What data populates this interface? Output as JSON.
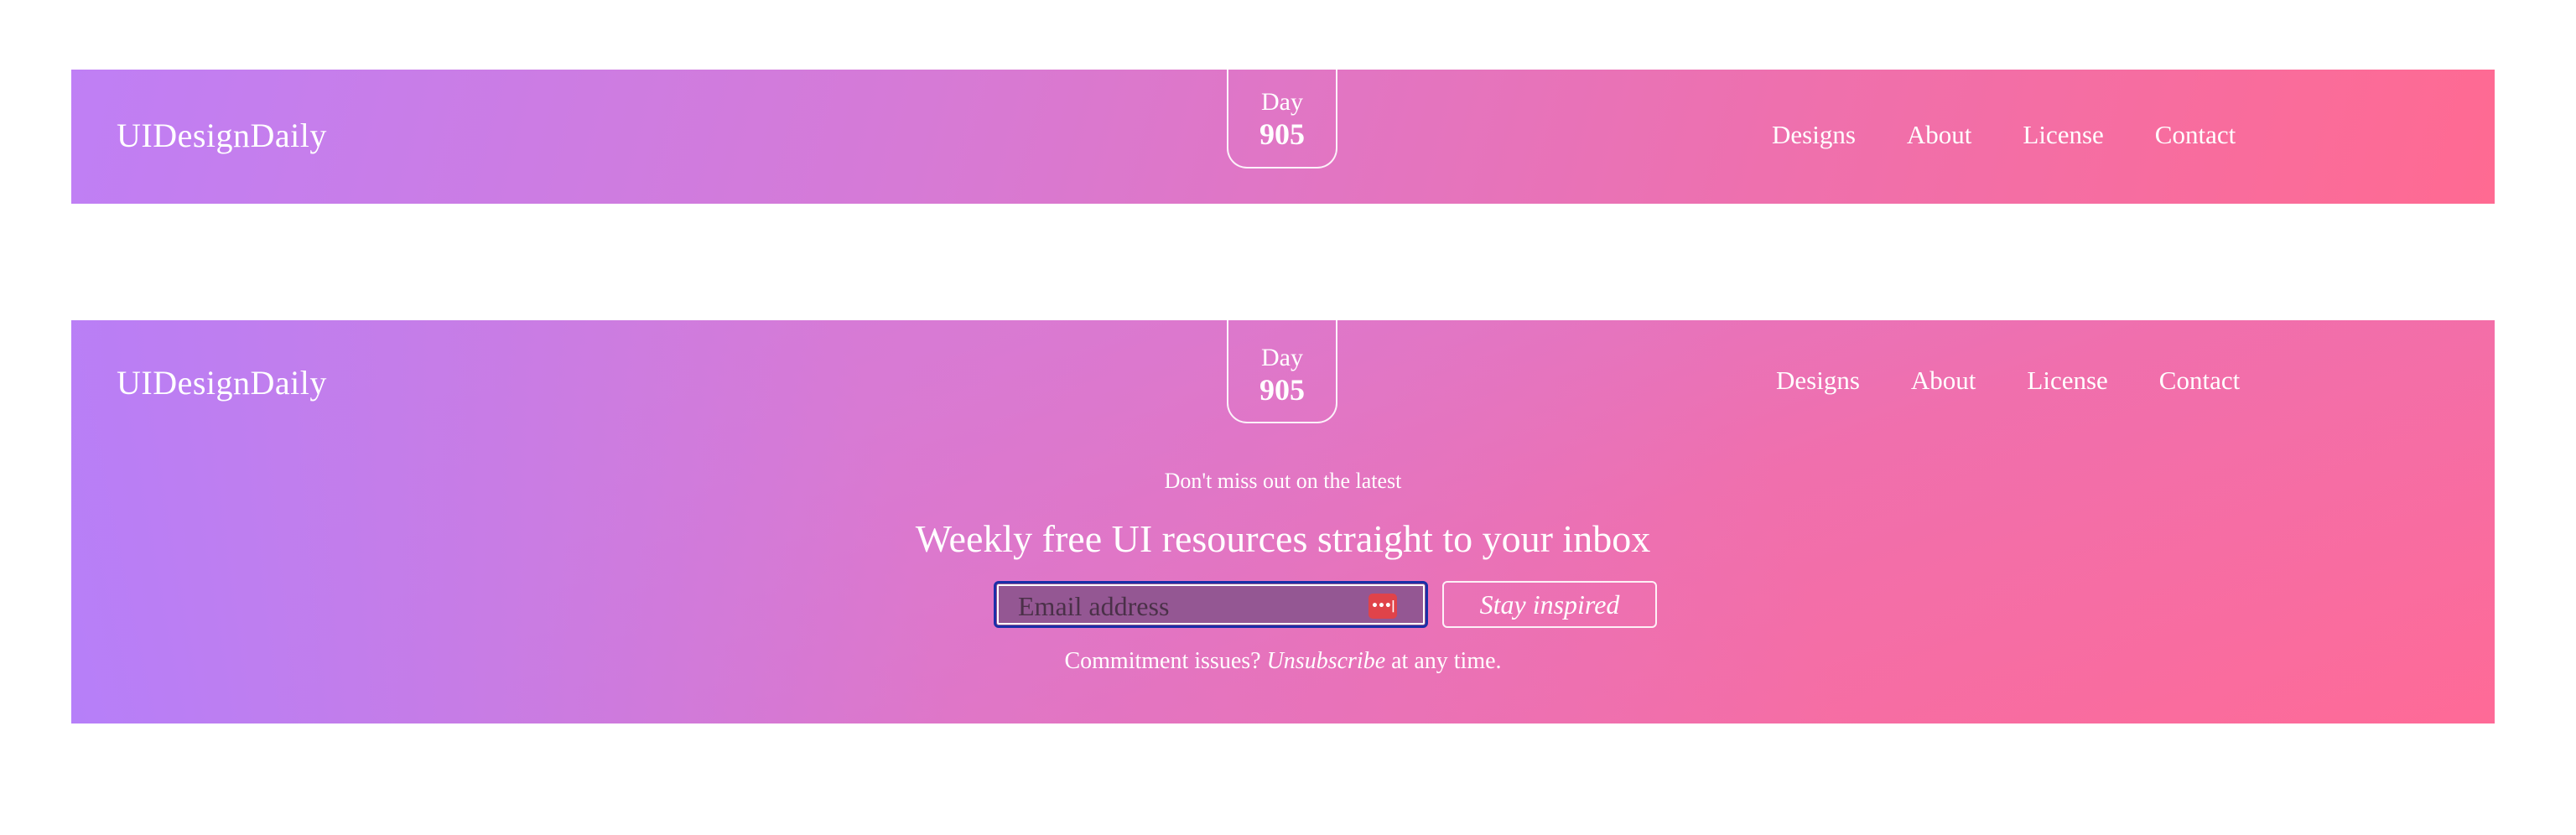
{
  "header_compact": {
    "logo": "UIDesignDaily",
    "day_label": "Day",
    "day_number": "905",
    "nav": [
      "Designs",
      "About",
      "License",
      "Contact"
    ]
  },
  "header_expanded": {
    "logo": "UIDesignDaily",
    "day_label": "Day",
    "day_number": "905",
    "nav": [
      "Designs",
      "About",
      "License",
      "Contact"
    ],
    "newsletter": {
      "kicker": "Don't miss out on the latest",
      "headline": "Weekly free UI resources straight to your inbox",
      "email_placeholder": "Email address",
      "password_manager_icon_text": "•••|",
      "cta_label": "Stay inspired",
      "fineprint_before": "Commitment issues?",
      "fineprint_link": "Unsubscribe",
      "fineprint_after": "at any time."
    }
  },
  "colors": {
    "gradient_start": "#bf7ff5",
    "gradient_end": "#ff6a92",
    "text": "#ffffff",
    "input_focus_ring": "#1a2fa8",
    "password_icon": "#e0434a"
  }
}
